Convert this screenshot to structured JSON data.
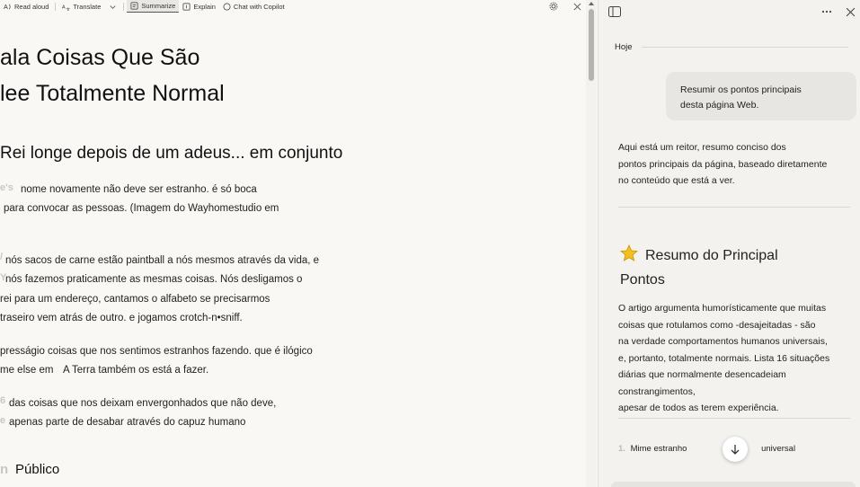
{
  "toolbar": {
    "read_aloud": "Read aloud",
    "translate": "Translate",
    "summarize": "Summarize",
    "explain": "Explain",
    "chat": "Chat with Copilot"
  },
  "article": {
    "title_line1": "ala Coisas Que São",
    "title_line2": "lee Totalmente Normal",
    "heading": "Rei longe depois de um adeus... em conjunto",
    "p1_l1": "nome novamente não deve ser estranho. é só boca",
    "p1_l2": "para convocar as pessoas. (Imagem do Wayhomestudio em",
    "p2_l1": "nós sacos de carne estão paintball a nós mesmos através da vida, e",
    "p2_l2": "nós fazemos praticamente as mesmas coisas. Nós desligamos o",
    "p2_l3": "rei para um endereço, cantamos o alfabeto se precisarmos",
    "p2_l4": "traseiro vem atrás de outro. e jogamos crotch-n•sniff.",
    "p3_l1": "presságio coisas que nos sentimos estranhos fazendo. que é ilógico",
    "p3_l2a": "me else em",
    "p3_l2b": "A Terra também os está a fazer.",
    "p4_l1": "das coisas que nos deixam envergonhados que não deve,",
    "p4_l2": "apenas parte de desabar através do capuz humano",
    "section": "Público"
  },
  "copilot": {
    "date": "Hoje",
    "user_msg_l1": "Resumir os pontos principais",
    "user_msg_l2": "desta página Web.",
    "reply_l1": "Aqui está um reitor, resumo conciso dos",
    "reply_l2": "pontos principais da página, baseado diretamente",
    "reply_l3": "no conteúdo que está a ver.",
    "summary_title_l1": "Resumo do Principal",
    "summary_title_l2": "Pontos",
    "summary_l1": "O artigo argumenta humorísticamente que muitas",
    "summary_l2": "coisas que rotulamos como -desajeitadas - são",
    "summary_l3": "na verdade comportamentos humanos universais,",
    "summary_l4": "e, portanto, totalmente normais. Lista 16 situações",
    "summary_l5": "diárias que normalmente desencadeiam constrangimentos,",
    "summary_l6": "apesar de todos as terem experiência.",
    "item1_num": "1.",
    "item1_a": "Mime estranho",
    "item1_b": "universal"
  }
}
